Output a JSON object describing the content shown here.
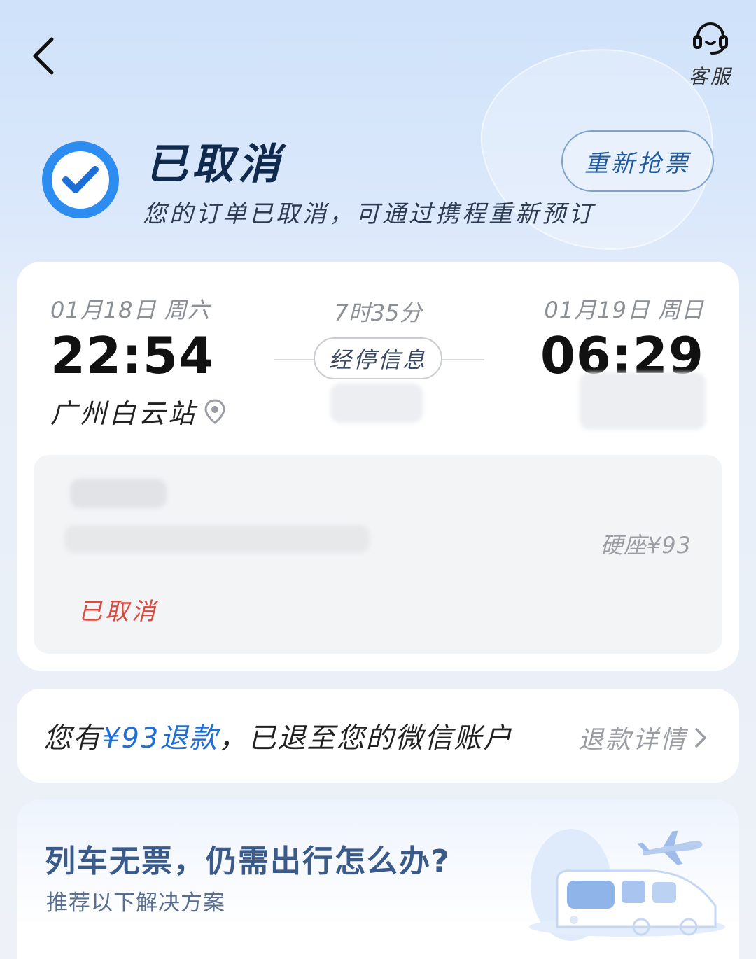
{
  "header": {
    "service_label": "客服"
  },
  "status": {
    "title": "已取消",
    "description": "您的订单已取消，可通过携程重新预订",
    "rebook_label": "重新抢票"
  },
  "trip": {
    "departure_date": "01月18日 周六",
    "arrival_date": "01月19日 周日",
    "duration": "7时35分",
    "departure_time": "22:54",
    "arrival_time": "06:29",
    "stop_info_label": "经停信息",
    "departure_station": "广州白云站"
  },
  "passenger": {
    "seat_price": "硬座¥93",
    "status": "已取消"
  },
  "refund": {
    "prefix": "您有",
    "amount": "¥93退款",
    "suffix": "，已退至您的微信账户",
    "detail_label": "退款详情"
  },
  "recommend": {
    "title": "列车无票，仍需出行怎么办?",
    "subtitle": "推荐以下解决方案"
  },
  "colors": {
    "accent": "#1f6fd6",
    "cancel_red": "#d94a3f",
    "title_navy": "#0f2a4d"
  }
}
